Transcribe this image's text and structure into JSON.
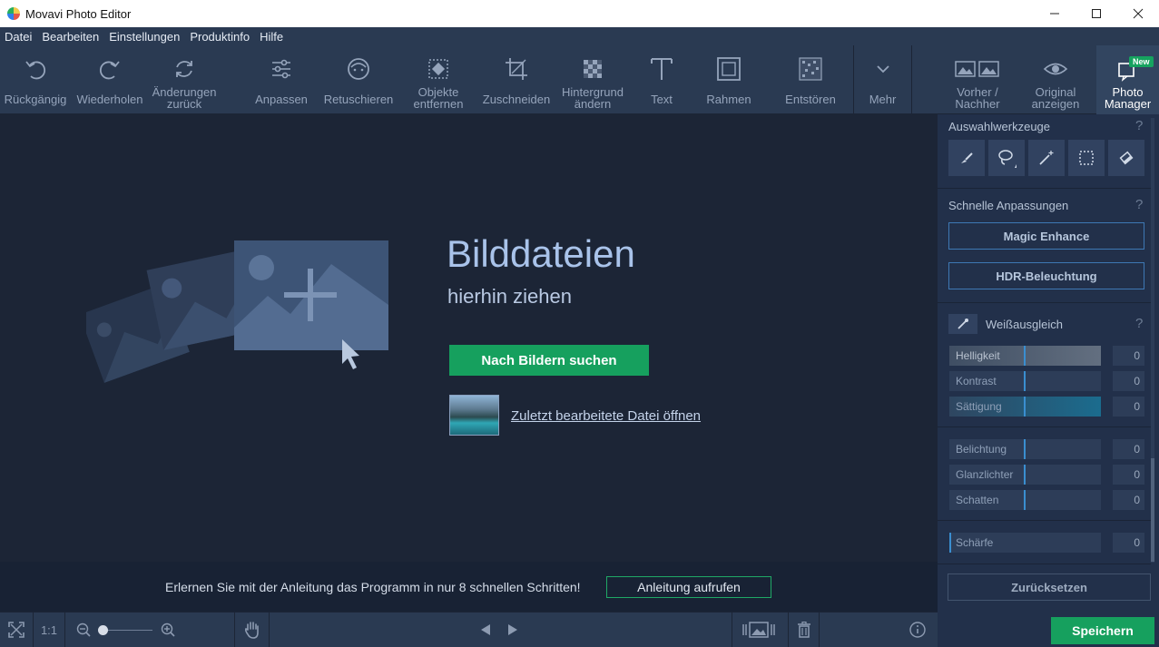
{
  "app": {
    "title": "Movavi Photo Editor"
  },
  "menu": [
    "Datei",
    "Bearbeiten",
    "Einstellungen",
    "Produktinfo",
    "Hilfe"
  ],
  "toolbar": {
    "undo": "Rückgängig",
    "redo": "Wiederholen",
    "revert": "Änderungen\nzurück",
    "adjust": "Anpassen",
    "retouch": "Retuschieren",
    "remove_objects": "Objekte\nentfernen",
    "crop": "Zuschneiden",
    "change_background": "Hintergrund\nändern",
    "text": "Text",
    "frames": "Rahmen",
    "denoise": "Entstören",
    "more": "Mehr",
    "before_after": "Vorher /\nNachher",
    "show_original": "Original\nanzeigen",
    "photo_manager": "Photo\nManager",
    "new_badge": "New"
  },
  "canvas": {
    "headline": "Bilddateien",
    "subline": "hierhin ziehen",
    "browse_button": "Nach Bildern suchen",
    "recent_link": "Zuletzt bearbeitete Datei öffnen"
  },
  "tutorial": {
    "text": "Erlernen Sie mit der Anleitung das Programm in nur 8 schnellen Schritten!",
    "button": "Anleitung aufrufen"
  },
  "bottombar": {
    "zoom_1to1": "1:1",
    "zoom_level": 0
  },
  "panel": {
    "selection_tools_title": "Auswahlwerkzeuge",
    "quick_adjust_title": "Schnelle Anpassungen",
    "magic_enhance": "Magic Enhance",
    "hdr": "HDR-Beleuchtung",
    "white_balance": "Weißausgleich",
    "help": "?",
    "sliders_group1": [
      {
        "name": "Helligkeit",
        "value": "0"
      },
      {
        "name": "Kontrast",
        "value": "0"
      },
      {
        "name": "Sättigung",
        "value": "0"
      }
    ],
    "sliders_group2": [
      {
        "name": "Belichtung",
        "value": "0"
      },
      {
        "name": "Glanzlichter",
        "value": "0"
      },
      {
        "name": "Schatten",
        "value": "0"
      }
    ],
    "sharpness": {
      "name": "Schärfe",
      "value": "0"
    },
    "reset": "Zurücksetzen",
    "save": "Speichern"
  },
  "colors": {
    "accent_green": "#16a05e",
    "toolbar_bg": "#2a3a52",
    "canvas_bg": "#1c2536"
  }
}
